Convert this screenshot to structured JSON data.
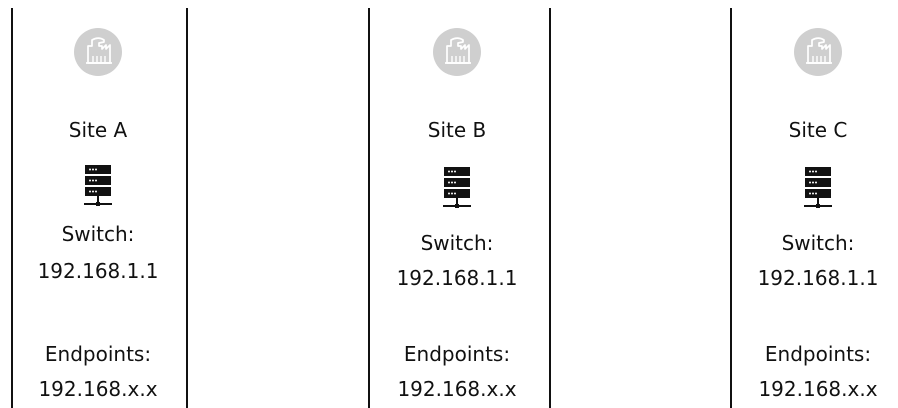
{
  "sites": [
    {
      "name": "Site A",
      "switch_label": "Switch:",
      "switch_ip": "192.168.1.1",
      "endpoints_label": "Endpoints:",
      "endpoints_ip": "192.168.x.x",
      "icon": "factory-icon",
      "switch_icon": "network-switch-icon"
    },
    {
      "name": "Site B",
      "switch_label": "Switch:",
      "switch_ip": "192.168.1.1",
      "endpoints_label": "Endpoints:",
      "endpoints_ip": "192.168.x.x",
      "icon": "factory-icon",
      "switch_icon": "network-switch-icon"
    },
    {
      "name": "Site C",
      "switch_label": "Switch:",
      "switch_ip": "192.168.1.1",
      "endpoints_label": "Endpoints:",
      "endpoints_ip": "192.168.x.x",
      "icon": "factory-icon",
      "switch_icon": "network-switch-icon"
    }
  ],
  "colors": {
    "line": "#111111",
    "icon_badge": "#cfcfcf",
    "icon_glyph": "#ffffff",
    "server_icon": "#111111"
  }
}
